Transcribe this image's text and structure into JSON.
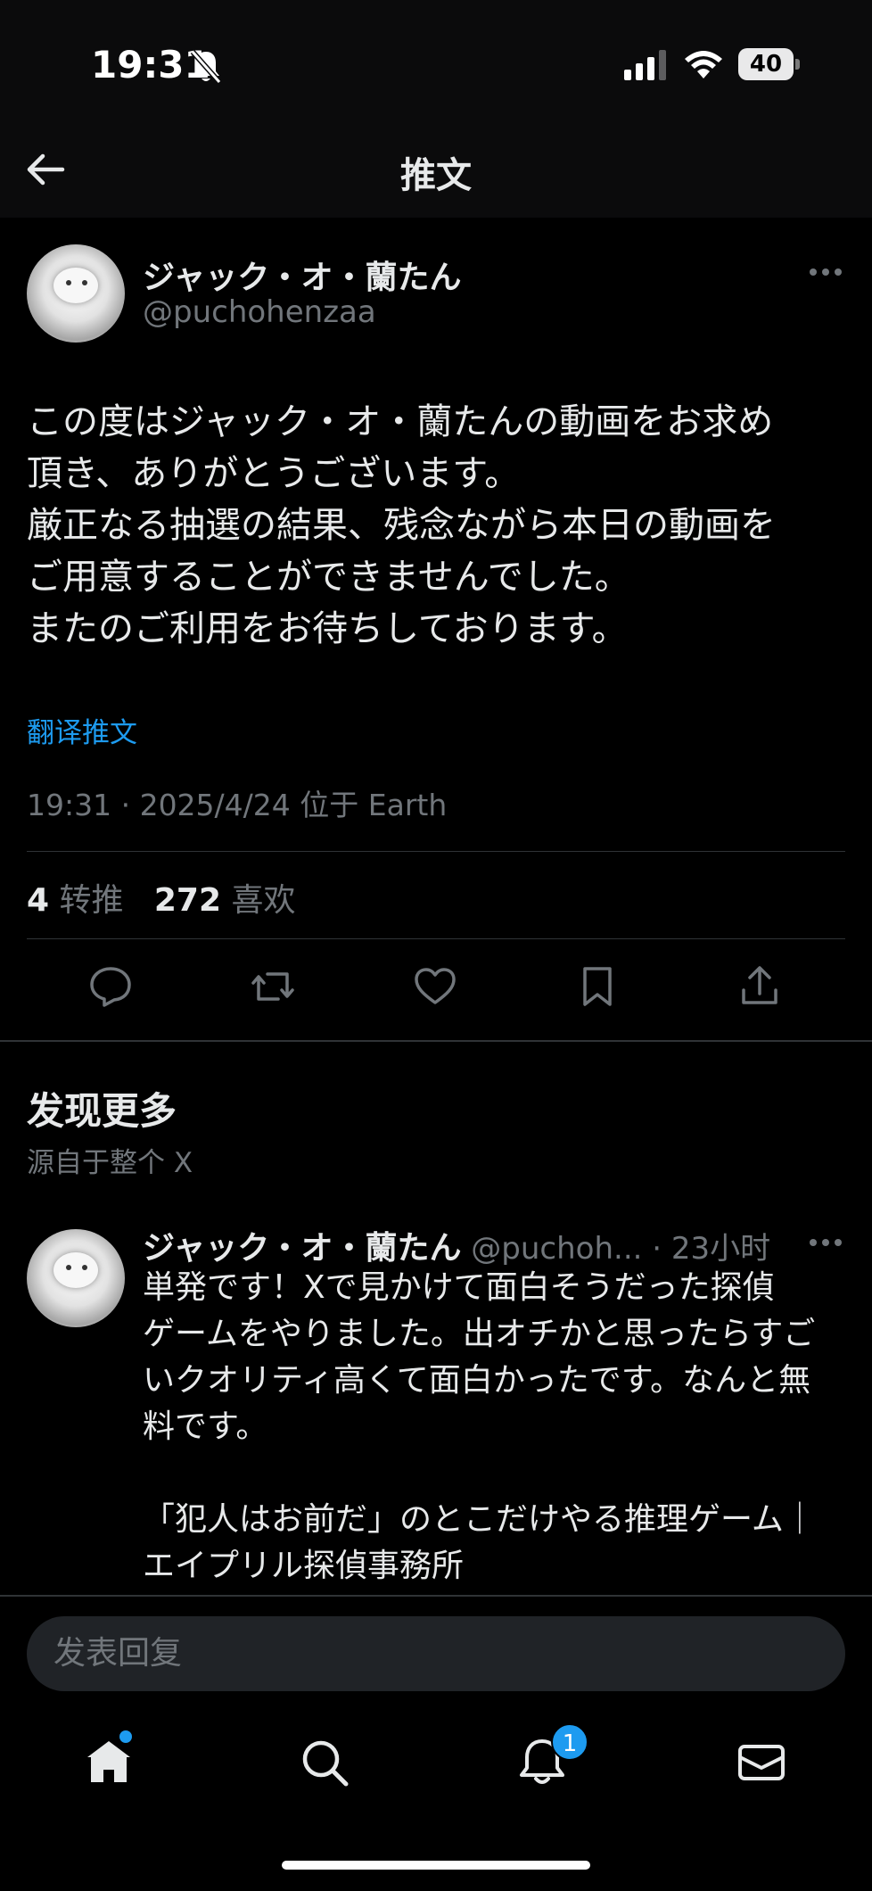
{
  "status_bar": {
    "time": "19:31",
    "battery": "40"
  },
  "header": {
    "title": "推文"
  },
  "tweet": {
    "author_name": "ジャック・オ・蘭たん",
    "author_handle": "@puchohenzaa",
    "text": "この度はジャック・オ・蘭たんの動画をお求め\n頂き、ありがとうございます。\n厳正なる抽選の結果、残念ながら本日の動画を\nご用意することができませんでした。\nまたのご利用をお待ちしております。",
    "translate_label": "翻译推文",
    "meta": "19:31 · 2025/4/24 位于 Earth",
    "retweet_count": "4",
    "retweet_label": "转推",
    "like_count": "272",
    "like_label": "喜欢"
  },
  "actions": [
    "reply-icon",
    "retweet-icon",
    "like-icon",
    "bookmark-icon",
    "share-icon"
  ],
  "discover": {
    "title": "发现更多",
    "subtitle": "源自于整个 X"
  },
  "recommended": {
    "author_name": "ジャック・オ・蘭たん",
    "handle_time": " @puchoh... · 23小时",
    "text": "単発です！Xで見かけて面白そうだった探偵\nゲームをやりました。出オチかと思ったらすご\nいクオリティ高くて面白かったです。なんと無\n料です。\n\n「犯人はお前だ」のとこだけやる推理ゲーム｜\nエイプリル探偵事務所"
  },
  "reply": {
    "placeholder": "发表回复"
  },
  "tab_bar": {
    "notification_badge": "1"
  },
  "colors": {
    "accent": "#1d9bf0",
    "background": "#000000",
    "secondary_text": "#71767b",
    "divider": "#2f3336"
  }
}
